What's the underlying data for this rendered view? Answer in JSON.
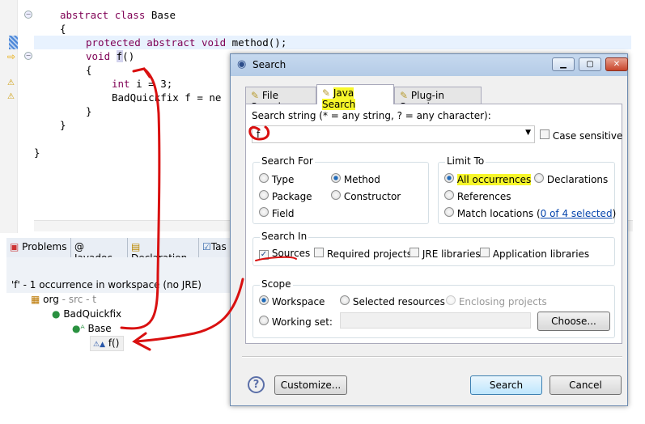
{
  "editor": {
    "lines": [
      {
        "kw": "abstract class ",
        "text": "Base"
      },
      {
        "kw": "",
        "text": "{"
      },
      {
        "kw": "protected abstract void ",
        "text": "method();"
      },
      {
        "kw": "void ",
        "text": "f()"
      },
      {
        "kw": "",
        "text": "{"
      },
      {
        "kw": "int ",
        "text": "i = 3;"
      },
      {
        "kw": "",
        "text": "BadQuickfix f = ne"
      },
      {
        "kw": "",
        "text": "}"
      },
      {
        "kw": "",
        "text": "}"
      },
      {
        "kw": "",
        "text": "}"
      }
    ]
  },
  "bottom_panel": {
    "tabs": [
      "Problems",
      "@ Javadoc",
      "Declaration",
      "Tas"
    ],
    "result_header": "'f' - 1 occurrence in workspace (no JRE)",
    "tree": {
      "package": "org",
      "package_suffix": " - src - t",
      "class": "BadQuickfix",
      "inner_class": "Base",
      "method": "f()"
    }
  },
  "dialog": {
    "title": "Search",
    "tabs": [
      "File Search",
      "Java Search",
      "Plug-in Search"
    ],
    "active_tab": "Java Search",
    "search_string_label": "Search string (* = any string, ? = any character):",
    "search_string_value": "f",
    "case_sensitive_label": "Case sensitive",
    "case_sensitive": false,
    "search_for": {
      "title": "Search For",
      "options": [
        "Type",
        "Method",
        "Package",
        "Constructor",
        "Field"
      ],
      "selected": "Method"
    },
    "limit_to": {
      "title": "Limit To",
      "options": [
        "All occurrences",
        "Declarations",
        "References",
        "Match locations"
      ],
      "selected": "All occurrences",
      "match_link": "0 of 4 selected"
    },
    "search_in": {
      "title": "Search In",
      "options": [
        {
          "label": "Sources",
          "checked": true
        },
        {
          "label": "Required projects",
          "checked": false
        },
        {
          "label": "JRE libraries",
          "checked": false
        },
        {
          "label": "Application libraries",
          "checked": false
        }
      ]
    },
    "scope": {
      "title": "Scope",
      "options": [
        "Workspace",
        "Selected resources",
        "Enclosing projects",
        "Working set:"
      ],
      "selected": "Workspace",
      "working_set_value": "",
      "choose_label": "Choose..."
    },
    "buttons": {
      "customize": "Customize...",
      "search": "Search",
      "cancel": "Cancel"
    },
    "highlight_color": "#f7f72a",
    "annotation_color": "#d91010"
  }
}
